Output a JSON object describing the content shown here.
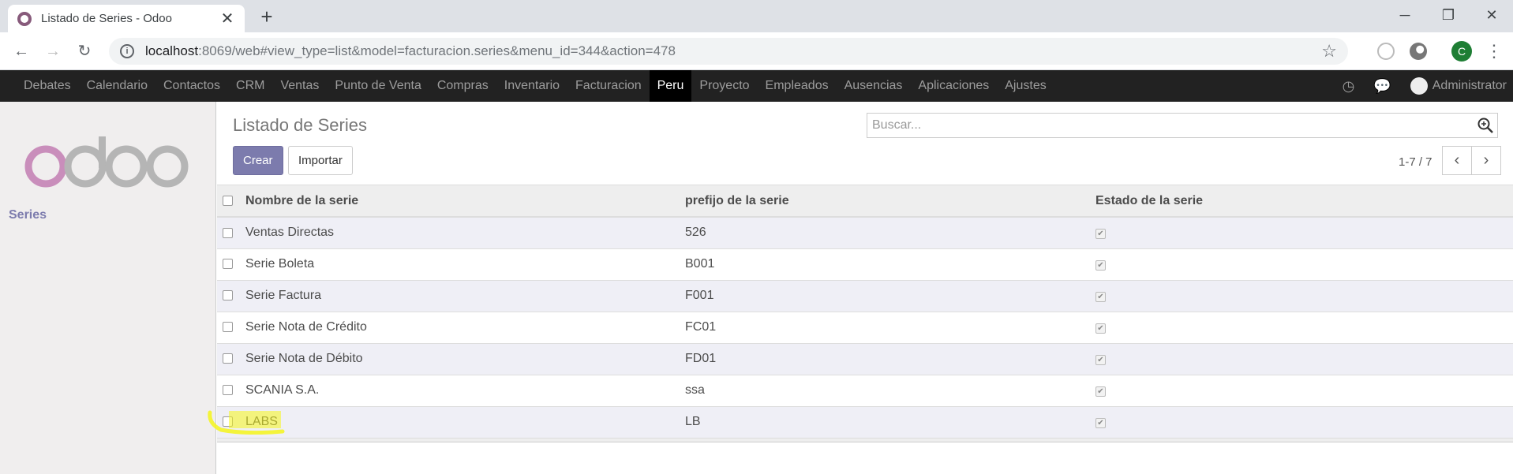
{
  "browser": {
    "tab_title": "Listado de Series - Odoo",
    "tab_close": "✕",
    "new_tab": "+",
    "url_host": "localhost",
    "url_rest": ":8069/web#view_type=list&model=facturacion.series&menu_id=344&action=478",
    "profile_initial": "C"
  },
  "menu": {
    "items": [
      "Debates",
      "Calendario",
      "Contactos",
      "CRM",
      "Ventas",
      "Punto de Venta",
      "Compras",
      "Inventario",
      "Facturacion",
      "Peru",
      "Proyecto",
      "Empleados",
      "Ausencias",
      "Aplicaciones",
      "Ajustes"
    ],
    "active": "Peru",
    "user": "Administrator"
  },
  "sidebar": {
    "items": [
      "Series"
    ]
  },
  "control_panel": {
    "title": "Listado de Series",
    "create_label": "Crear",
    "import_label": "Importar",
    "search_placeholder": "Buscar...",
    "pager": "1-7 / 7"
  },
  "table": {
    "columns": [
      "Nombre de la serie",
      "prefijo de la serie",
      "Estado de la serie"
    ],
    "rows": [
      {
        "nombre": "Ventas Directas",
        "prefijo": "526",
        "estado": true
      },
      {
        "nombre": "Serie Boleta",
        "prefijo": "B001",
        "estado": true
      },
      {
        "nombre": "Serie Factura",
        "prefijo": "F001",
        "estado": true
      },
      {
        "nombre": "Serie Nota de Crédito",
        "prefijo": "FC01",
        "estado": true
      },
      {
        "nombre": "Serie Nota de Débito",
        "prefijo": "FD01",
        "estado": true
      },
      {
        "nombre": "SCANIA S.A.",
        "prefijo": "ssa",
        "estado": true
      },
      {
        "nombre": "LABS",
        "prefijo": "LB",
        "estado": true
      }
    ]
  },
  "colors": {
    "odoo_purple": "#7c7bad",
    "menu_bg": "#222222",
    "highlight": "#f5f51a"
  }
}
